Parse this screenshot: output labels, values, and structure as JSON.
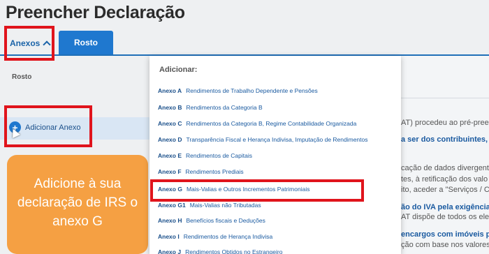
{
  "page": {
    "title": "Preencher Declaração"
  },
  "tabs": [
    {
      "label": "Anexos"
    },
    {
      "label": "Rosto"
    }
  ],
  "left": {
    "rosto_label": "Rosto",
    "add_annex_label": "Adicionar Anexo"
  },
  "callout": {
    "text": "Adicione à sua declaração de IRS o anexo G"
  },
  "menu": {
    "title": "Adicionar:",
    "items": [
      {
        "code": "Anexo A",
        "label": "Rendimentos de Trabalho Dependente e Pensões"
      },
      {
        "code": "Anexo B",
        "label": "Rendimentos da Categoria B"
      },
      {
        "code": "Anexo C",
        "label": "Rendimentos da Categoria B, Regime Contabilidade Organizada"
      },
      {
        "code": "Anexo D",
        "label": "Transparência Fiscal e Herança Indivisa, Imputação de Rendimentos"
      },
      {
        "code": "Anexo E",
        "label": "Rendimentos de Capitais"
      },
      {
        "code": "Anexo F",
        "label": "Rendimentos Prediais"
      },
      {
        "code": "Anexo G",
        "label": "Mais-Valias e Outros Incrementos Patrimoniais"
      },
      {
        "code": "Anexo G1",
        "label": "Mais-Valias não Tributadas"
      },
      {
        "code": "Anexo H",
        "label": "Benefícios fiscais e Deduções"
      },
      {
        "code": "Anexo I",
        "label": "Rendimentos de Herança Indivisa"
      },
      {
        "code": "Anexo J",
        "label": "Rendimentos Obtidos no Estrangeiro"
      }
    ]
  },
  "background_text": [
    {
      "text": "AT) procedeu ao pré-preen",
      "style": "normal"
    },
    {
      "text": "a ser dos contribuintes, p",
      "style": "blue"
    },
    {
      "text": "cação de dados divergent",
      "style": "normal"
    },
    {
      "text": "tes, à retificação dos valo",
      "style": "normal"
    },
    {
      "text": "ito, aceder a \"Serviços / C",
      "style": "normal"
    },
    {
      "text": "ão do IVA pela exigência d",
      "style": "blue"
    },
    {
      "text": "AT dispõe de todos os ele",
      "style": "normal"
    },
    {
      "text": "encargos com imóveis pa",
      "style": "blue"
    },
    {
      "text": "ção com base nos valores",
      "style": "normal"
    }
  ]
}
